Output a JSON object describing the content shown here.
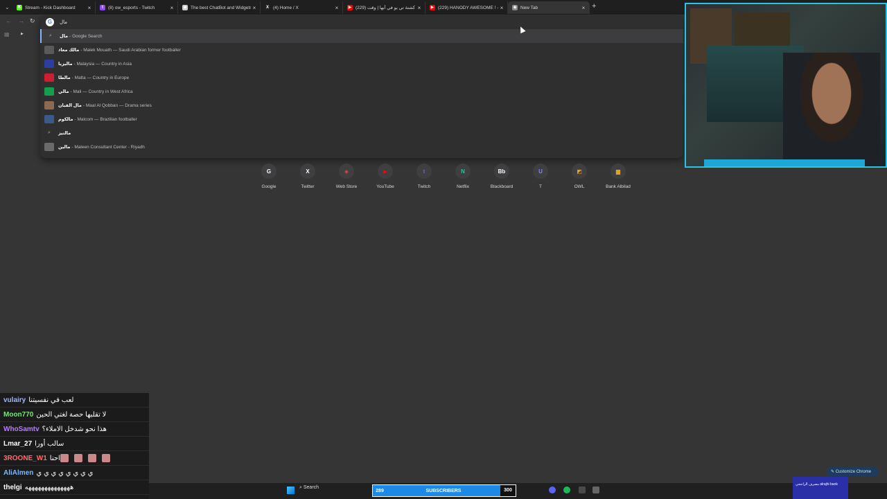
{
  "tabs": [
    {
      "title": "Stream - Kick Dashboard",
      "color": "#53fc18",
      "glyph": "K"
    },
    {
      "title": "(8) ow_esports - Twitch",
      "color": "#9146ff",
      "glyph": "t"
    },
    {
      "title": "The best ChatBot and Widgets",
      "color": "#cccccc",
      "glyph": "◆"
    },
    {
      "title": "(4) Home / X",
      "color": "#222222",
      "glyph": "X"
    },
    {
      "title": "(229) كشتة تي يو في أبها | وقت",
      "color": "#ff0000",
      "glyph": "▶"
    },
    {
      "title": "(229) HANODY AWESOME ! - Y",
      "color": "#ff0000",
      "glyph": "▶"
    },
    {
      "title": "New Tab",
      "color": "#888888",
      "glyph": "◉"
    }
  ],
  "omnibox": {
    "query": "مال",
    "suggestions": [
      {
        "q": "مال",
        "desc": "- Google Search",
        "kind": "search",
        "thumb": ""
      },
      {
        "q": "مالك معاذ",
        "desc": "- Malek Mouath — Saudi Arabian former footballer",
        "kind": "entity",
        "thumb": "#5a5a5a"
      },
      {
        "q": "ماليزيا",
        "desc": "- Malaysia — Country in Asia",
        "kind": "entity",
        "thumb": "#2c3fa0"
      },
      {
        "q": "مالطا",
        "desc": "- Malta — Country in Europe",
        "kind": "entity",
        "thumb": "#cc2030"
      },
      {
        "q": "مالي",
        "desc": "- Mali — Country in West Africa",
        "kind": "entity",
        "thumb": "#14a04a"
      },
      {
        "q": "مال القبان",
        "desc": "- Maal Al Qobban — Drama series",
        "kind": "entity",
        "thumb": "#8a6a50"
      },
      {
        "q": "مالكوم",
        "desc": "- Malcom — Brazilian footballer",
        "kind": "entity",
        "thumb": "#3a5a8a"
      },
      {
        "q": "مالتيز",
        "desc": "",
        "kind": "search",
        "thumb": ""
      },
      {
        "q": "مالين",
        "desc": "- Maleen Consultant Center - Riyadh",
        "kind": "entity",
        "thumb": "#6a6a6a"
      }
    ]
  },
  "shortcuts": [
    {
      "label": "Google",
      "glyph": "G",
      "color": "#ffffff"
    },
    {
      "label": "Twitter",
      "glyph": "X",
      "color": "#ffffff"
    },
    {
      "label": "Web Store",
      "glyph": "◈",
      "color": "#e44"
    },
    {
      "label": "YouTube",
      "glyph": "▶",
      "color": "#ff0000"
    },
    {
      "label": "Twitch",
      "glyph": "t",
      "color": "#9146ff"
    },
    {
      "label": "Netflix",
      "glyph": "N",
      "color": "#1ec8a0"
    },
    {
      "label": "Blackboard",
      "glyph": "Bb",
      "color": "#ffffff"
    },
    {
      "label": "T",
      "glyph": "U",
      "color": "#8a8aff"
    },
    {
      "label": "OWL",
      "glyph": "◩",
      "color": "#f0a020"
    },
    {
      "label": "Bank Albilad",
      "glyph": "▆",
      "color": "#e0a020"
    }
  ],
  "chat": [
    {
      "user": "vulairy",
      "color": "#9ab8ff",
      "text": "لعب في نفسيتنا"
    },
    {
      "user": "Moon770",
      "color": "#7fe07f",
      "text": "لا تقلبها حصة لغتي الحين"
    },
    {
      "user": "WhoSamtv",
      "color": "#b57cff",
      "text": "هذا نحو شدخل الاملاء؟"
    },
    {
      "user": "Lmar_27",
      "color": "#ffffff",
      "text": "سالب أورا"
    },
    {
      "user": "3ROONE_W1",
      "color": "#ff6a6a",
      "text": "احنا"
    },
    {
      "user": "AliAlmen",
      "color": "#7fb8ff",
      "text": "ي ي ي ي ي ي ي ي"
    },
    {
      "user": "thelgi",
      "color": "#ffffff",
      "text": "ههههههههههههههه"
    }
  ],
  "taskbar": {
    "search": "Search",
    "subs_count": "289",
    "subs_label": "SUBSCRIBERS",
    "subs_goal": "300"
  },
  "customize_label": "Customize Chrome",
  "bank_ad": "مصرف الراجحي alrajhi bank"
}
